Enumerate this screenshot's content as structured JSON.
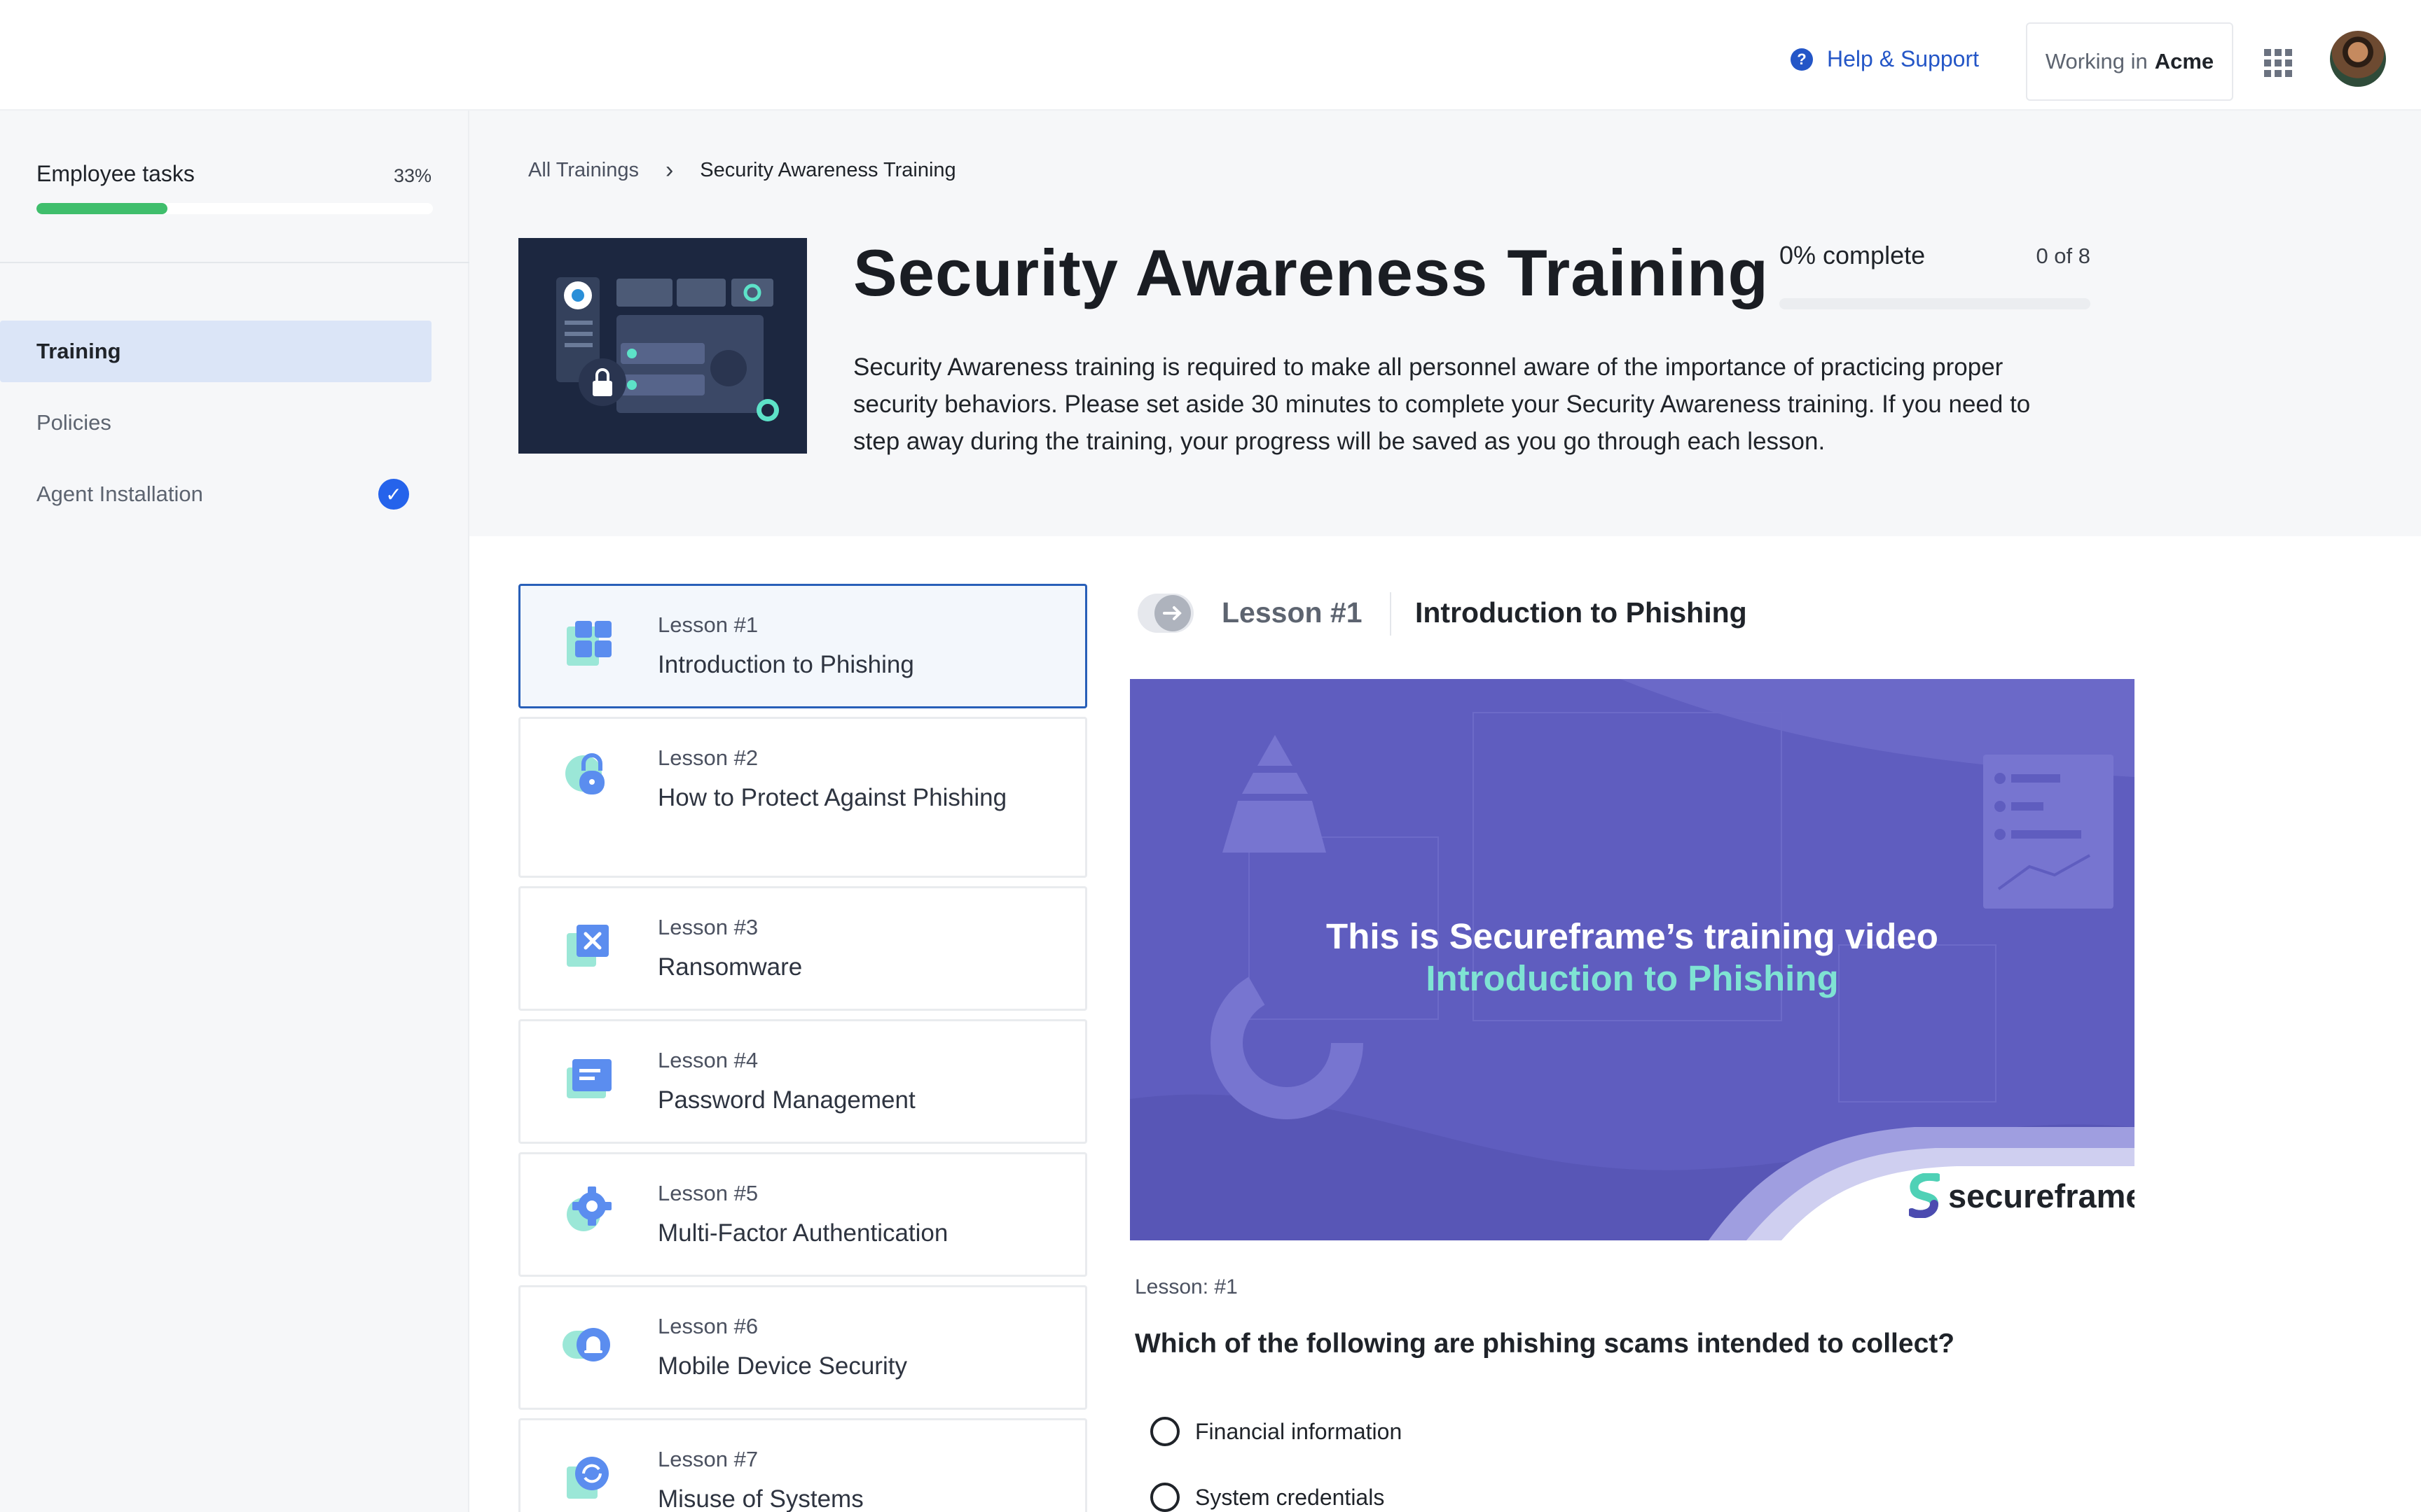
{
  "topbar": {
    "help_label": "Help & Support",
    "working_prefix": "Working in",
    "workspace": "Acme"
  },
  "sidebar": {
    "tasks_label": "Employee tasks",
    "tasks_progress": "33%",
    "tasks_progress_value": 0.33,
    "items": [
      {
        "label": "Training",
        "active": true
      },
      {
        "label": "Policies",
        "active": false
      },
      {
        "label": "Agent Installation",
        "completed": true
      }
    ]
  },
  "breadcrumb": {
    "root": "All Trainings",
    "current": "Security Awareness Training"
  },
  "training": {
    "title": "Security Awareness Training",
    "description": "Security Awareness training is required to make all personnel aware of the importance of practicing proper security behaviors. Please set aside 30 minutes to complete your Security Awareness training. If you need to step away during the training, your progress will be saved as you go through each lesson.",
    "complete_label": "0% complete",
    "complete_count": "0 of 8",
    "complete_value": 0
  },
  "lessons": [
    {
      "num": "Lesson #1",
      "name": "Introduction to Phishing",
      "icon": "grid-icon"
    },
    {
      "num": "Lesson #2",
      "name": "How to Protect Against Phishing",
      "icon": "lock-icon"
    },
    {
      "num": "Lesson #3",
      "name": "Ransomware",
      "icon": "x-box-icon"
    },
    {
      "num": "Lesson #4",
      "name": "Password Management",
      "icon": "id-card-icon"
    },
    {
      "num": "Lesson #5",
      "name": "Multi-Factor Authentication",
      "icon": "gear-icon"
    },
    {
      "num": "Lesson #6",
      "name": "Mobile Device Security",
      "icon": "bell-icon"
    },
    {
      "num": "Lesson #7",
      "name": "Misuse of Systems",
      "icon": "refresh-icon"
    }
  ],
  "detail": {
    "num": "Lesson #1",
    "name": "Introduction to Phishing",
    "video_line1": "This is Secureframe’s training video",
    "video_line2": "Introduction to Phishing",
    "video_brand": "secureframe",
    "lesson_tag": "Lesson: #1",
    "question": "Which of the following are phishing scams intended to collect?",
    "options": [
      "Financial information",
      "System credentials"
    ]
  },
  "colors": {
    "accent": "#2456c7",
    "progress": "#3fbe6c",
    "video_bg": "#5f5dbf",
    "video_highlight": "#7fe3d3"
  }
}
